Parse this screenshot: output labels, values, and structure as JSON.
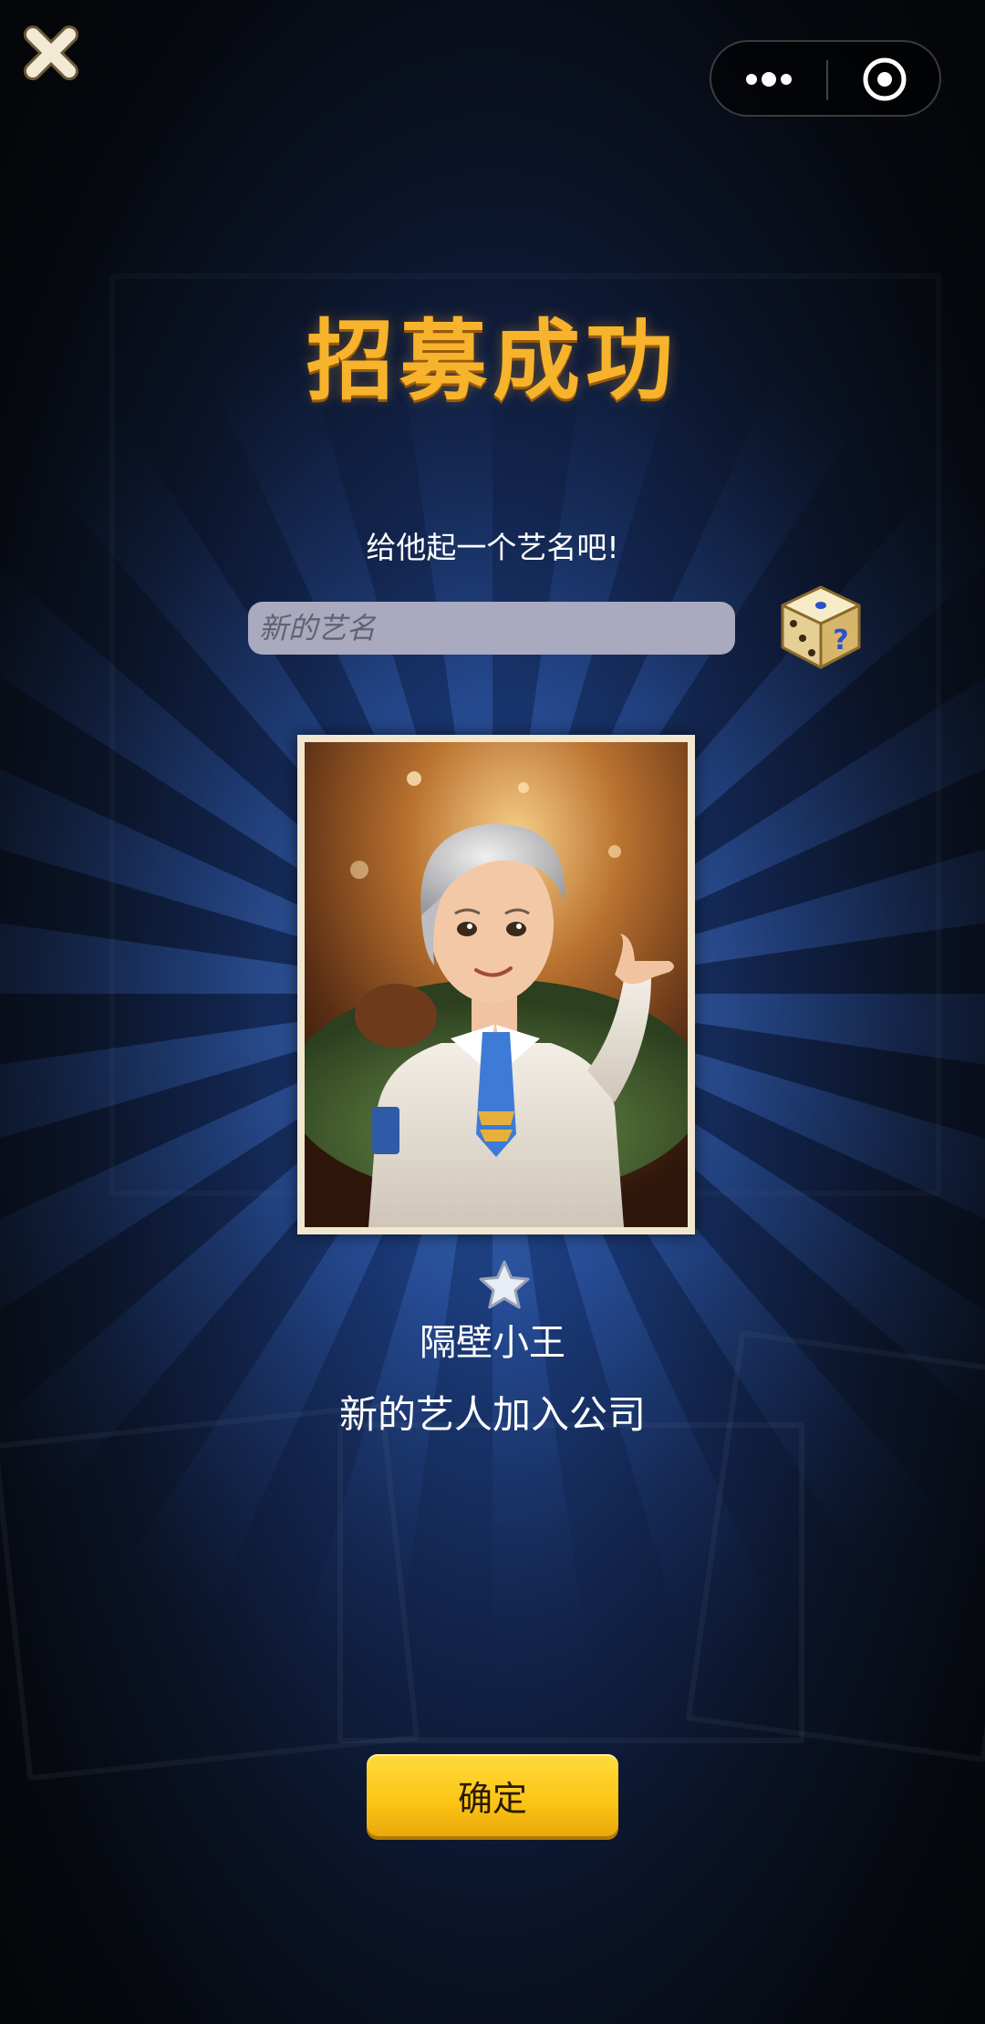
{
  "header": {
    "close_icon": "close-x-icon",
    "capsule": {
      "more_icon": "more-dots-icon",
      "target_icon": "target-circle-icon"
    }
  },
  "main": {
    "title": "招募成功",
    "prompt": "给他起一个艺名吧!",
    "name_input": {
      "value": "",
      "placeholder": "新的艺名"
    },
    "dice_icon": "dice-random-icon",
    "portrait_icon": "artist-portrait-card",
    "star_rating": 1,
    "star_icon": "star-icon",
    "artist_name": "隔壁小王",
    "message": "新的艺人加入公司"
  },
  "footer": {
    "confirm_label": "确定"
  },
  "colors": {
    "title": "#f7b32b",
    "button": "#fcc414",
    "input_bg": "#a9a9bf",
    "card_border": "#f1e7cf"
  }
}
